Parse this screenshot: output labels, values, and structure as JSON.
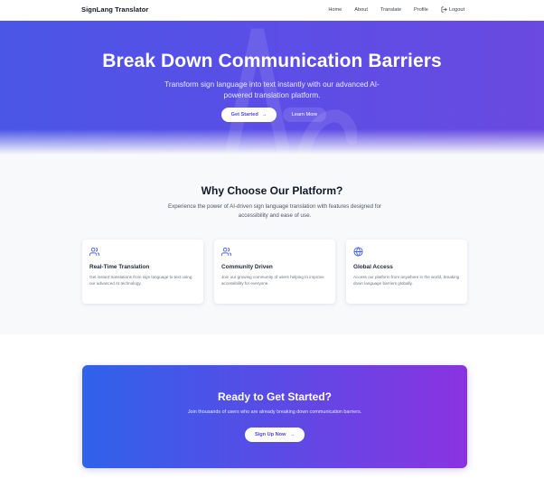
{
  "nav": {
    "brand": "SignLang Translator",
    "links": [
      "Home",
      "About",
      "Translate",
      "Profile"
    ],
    "logout": "Logout",
    "logout_icon": "logout-icon"
  },
  "hero": {
    "title": "Break Down Communication Barriers",
    "subtitle": "Transform sign language into text instantly with our advanced AI-powered translation platform.",
    "primary_button": "Get Started",
    "primary_button_icon": "arrow-right-icon",
    "secondary_button": "Learn More",
    "gradient": [
      "#4a56e6",
      "#6a4ae0"
    ]
  },
  "features": {
    "title": "Why Choose Our Platform?",
    "subtitle": "Experience the power of AI-driven sign language translation with features designed for accessibility and ease of use.",
    "cards": [
      {
        "icon": "users-icon",
        "title": "Real-Time Translation",
        "text": "Get instant translations from sign language to text using our advanced AI technology."
      },
      {
        "icon": "users-icon",
        "title": "Community Driven",
        "text": "Join our growing community of users helping to improve accessibility for everyone."
      },
      {
        "icon": "globe-icon",
        "title": "Global Access",
        "text": "Access our platform from anywhere in the world, breaking down language barriers globally."
      }
    ]
  },
  "cta": {
    "title": "Ready to Get Started?",
    "subtitle": "Join thousands of users who are already breaking down communication barriers.",
    "button": "Sign Up Now",
    "button_icon": "arrow-right-icon",
    "gradient": [
      "#2f62ea",
      "#8a33e0"
    ]
  },
  "colors": {
    "accent": "#4f46e5",
    "icon": "#4f63e8"
  }
}
